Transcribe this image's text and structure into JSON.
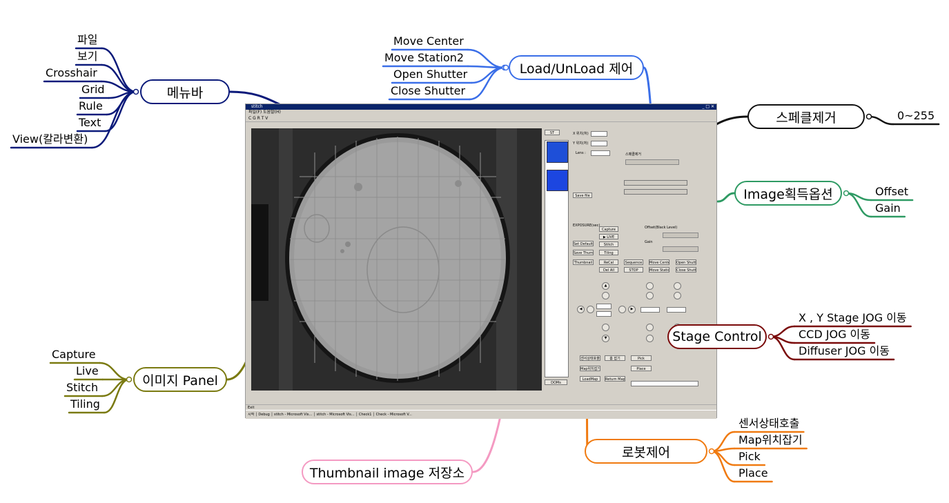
{
  "colors": {
    "menubar": "#0b1a7a",
    "load": "#3a6ee8",
    "speckle": "#111111",
    "image_options": "#2e9a63",
    "stage": "#7a0a0a",
    "robot": "#f07a10",
    "thumbnail": "#f49ac2",
    "image_panel": "#7a7a10"
  },
  "groups": [
    {
      "hub": "메뉴바",
      "color_key": "menubar",
      "leaves": [
        "파일",
        "보기",
        "Crosshair",
        "Grid",
        "Rule",
        "Text",
        "View(칼라변환)"
      ]
    },
    {
      "hub": "Load/UnLoad 제어",
      "color_key": "load",
      "leaves": [
        "Move Center",
        "Move Station2",
        "Open Shutter",
        "Close Shutter"
      ]
    },
    {
      "hub": "스페클제거",
      "color_key": "speckle",
      "leaves": [
        "0~255"
      ]
    },
    {
      "hub": "Image획득옵션",
      "color_key": "image_options",
      "leaves": [
        "Offset",
        "Gain"
      ]
    },
    {
      "hub": "Stage Control",
      "color_key": "stage",
      "leaves": [
        "X , Y Stage JOG 이동",
        "CCD JOG 이동",
        "Diffuser JOG 이동"
      ]
    },
    {
      "hub": "이미지 Panel",
      "color_key": "image_panel",
      "leaves": [
        "Capture",
        "Live",
        "Stitch",
        "Tiling"
      ]
    },
    {
      "hub": "Thumbnail image 저장소",
      "color_key": "thumbnail",
      "leaves": []
    },
    {
      "hub": "로봇제어",
      "color_key": "robot",
      "leaves": [
        "센서상태호출",
        "Map위치잡기",
        "Pick",
        "Place"
      ]
    }
  ],
  "screenshot": {
    "menu_items": "파일(F)   도움말(H)",
    "toolbar_items": "C  G  R  T  V",
    "buttons": [
      "Move Center",
      "Move Station2",
      "Open Shutter",
      "Close Shutter",
      "Capture",
      "▶ LIVE",
      "Stitch",
      "Tiling",
      "Sequence",
      "STOP",
      "Thumbnail",
      "ReCal",
      "Del All",
      "Set Default",
      "Save Thumb",
      "Save file",
      "Pick",
      "Place",
      "Return Map"
    ],
    "labels": [
      "X 위치(처)",
      "Y 위치(처)",
      "Lens :",
      "EXPOSURE(sec)",
      "Offset(Black Level)",
      "Gain",
      "스페클제거"
    ]
  }
}
